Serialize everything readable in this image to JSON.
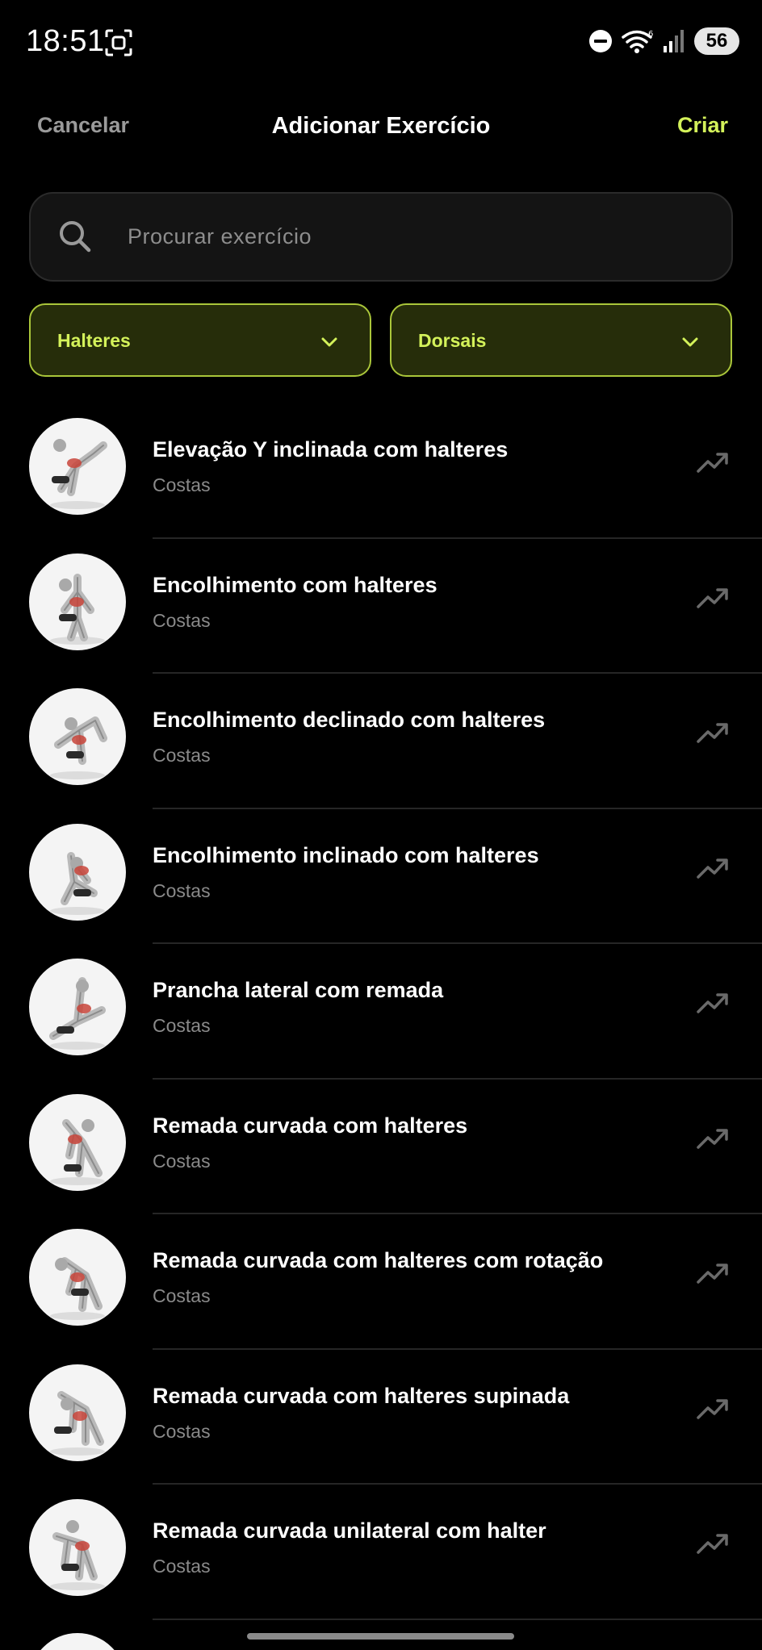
{
  "status_bar": {
    "time": "18:51",
    "battery": "56",
    "icons": [
      "screenshot-icon",
      "dnd-icon",
      "wifi-icon",
      "signal-icon",
      "battery-icon"
    ]
  },
  "header": {
    "cancel_label": "Cancelar",
    "title": "Adicionar Exercício",
    "create_label": "Criar"
  },
  "search": {
    "placeholder": "Procurar exercício"
  },
  "filters": {
    "equipment": "Halteres",
    "muscle": "Dorsais"
  },
  "colors": {
    "accent": "#d4f25a",
    "filter_bg": "#262d0a",
    "filter_border": "#aac63a",
    "background": "#000000",
    "muted_text": "#8a8a8a"
  },
  "exercises": [
    {
      "name": "Elevação Y inclinada com halteres",
      "muscle": "Costas"
    },
    {
      "name": "Encolhimento com halteres",
      "muscle": "Costas"
    },
    {
      "name": "Encolhimento declinado com halteres",
      "muscle": "Costas"
    },
    {
      "name": "Encolhimento inclinado com halteres",
      "muscle": "Costas"
    },
    {
      "name": "Prancha lateral com remada",
      "muscle": "Costas"
    },
    {
      "name": "Remada curvada com halteres",
      "muscle": "Costas"
    },
    {
      "name": "Remada curvada com halteres com rotação",
      "muscle": "Costas"
    },
    {
      "name": "Remada curvada com halteres supinada",
      "muscle": "Costas"
    },
    {
      "name": "Remada curvada unilateral com halter",
      "muscle": "Costas"
    }
  ]
}
